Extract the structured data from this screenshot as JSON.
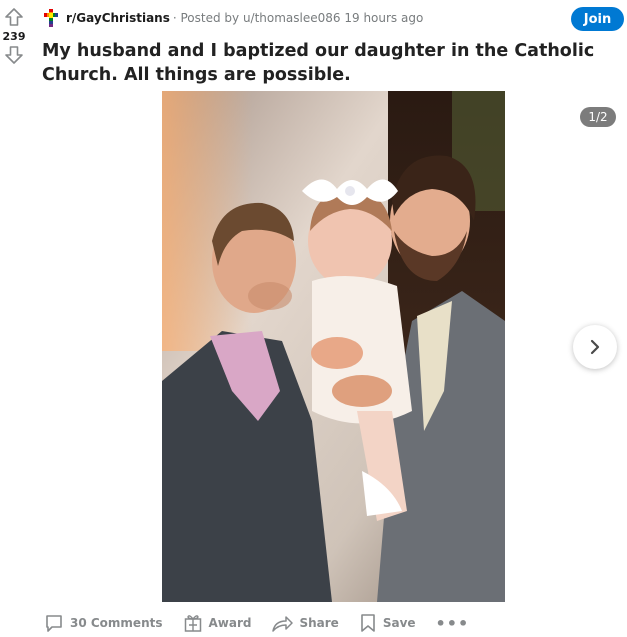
{
  "post": {
    "score": "239",
    "subreddit": "r/GayChristians",
    "posted_by": "· Posted by u/thomaslee086 19 hours ago",
    "title": "My husband and I baptized our daughter in the Catholic Church. All things are possible.",
    "join_label": "Join",
    "gallery_counter": "1/2"
  },
  "actions": {
    "comments": "30 Comments",
    "award": "Award",
    "share": "Share",
    "save": "Save",
    "more": "•••"
  },
  "colors": {
    "join_button": "#0079d3",
    "action_text": "#878a8c",
    "counter_bg": "#7c7c7c"
  },
  "icons": [
    "upvote-icon",
    "downvote-icon",
    "rainbow-cross-icon",
    "chevron-right-icon",
    "comment-icon",
    "award-icon",
    "share-icon",
    "bookmark-icon",
    "more-icon"
  ]
}
